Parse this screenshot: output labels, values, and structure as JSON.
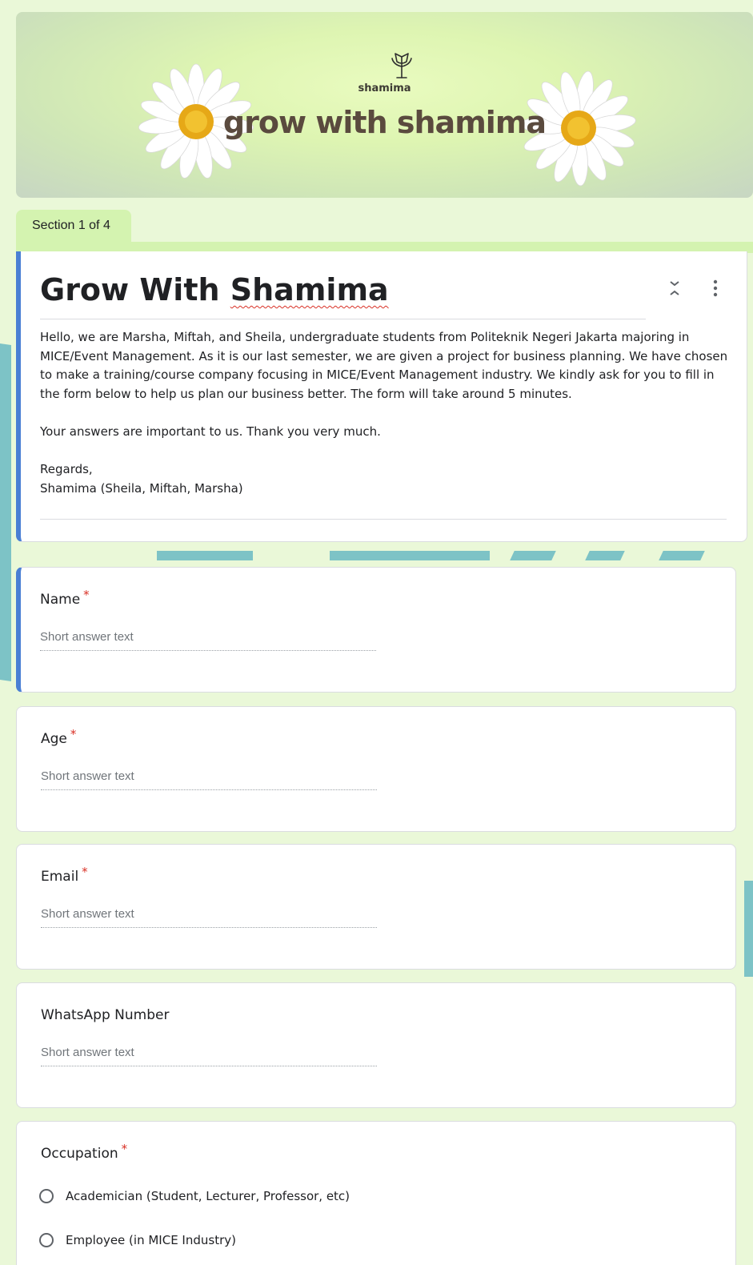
{
  "banner": {
    "brand_small": "shamima",
    "title": "grow with shamima",
    "logo_icon": "tulip-logo-icon",
    "decorations": [
      "daisy-flower-icon",
      "daisy-flower-icon"
    ]
  },
  "section": {
    "label": "Section 1 of 4"
  },
  "intro": {
    "title_lead": "Grow With ",
    "title_name": "Shamima",
    "description": "Hello, we are Marsha, Miftah, and Sheila, undergraduate students from Politeknik Negeri Jakarta majoring in MICE/Event Management. As it is our last semester, we are given a project for business planning. We have chosen to make a training/course company focusing in MICE/Event Management industry. We kindly ask for you to fill in the form below to help us plan our business better. The form will take around 5 minutes.\n\nYour answers are important to us. Thank you very much.\n\nRegards,\nShamima (Sheila, Miftah, Marsha)",
    "collapse_icon": "collapse-section-icon",
    "more_icon": "more-options-icon"
  },
  "questions": [
    {
      "label": "Name",
      "required_mark": "*",
      "placeholder": "Short answer text"
    },
    {
      "label": "Age",
      "required_mark": "*",
      "placeholder": "Short answer text"
    },
    {
      "label": "Email",
      "required_mark": "*",
      "placeholder": "Short answer text"
    },
    {
      "label": "WhatsApp Number",
      "required_mark": "",
      "placeholder": "Short answer text"
    }
  ],
  "occupation": {
    "label": "Occupation",
    "required_mark": "*",
    "options": [
      "Academician (Student, Lecturer, Professor, etc)",
      "Employee (in MICE Industry)"
    ]
  },
  "colors": {
    "accent": "#4a7fd4",
    "required": "#d93025",
    "page_bg": "#eaf8d8",
    "section_bg": "#d4f3b0"
  }
}
